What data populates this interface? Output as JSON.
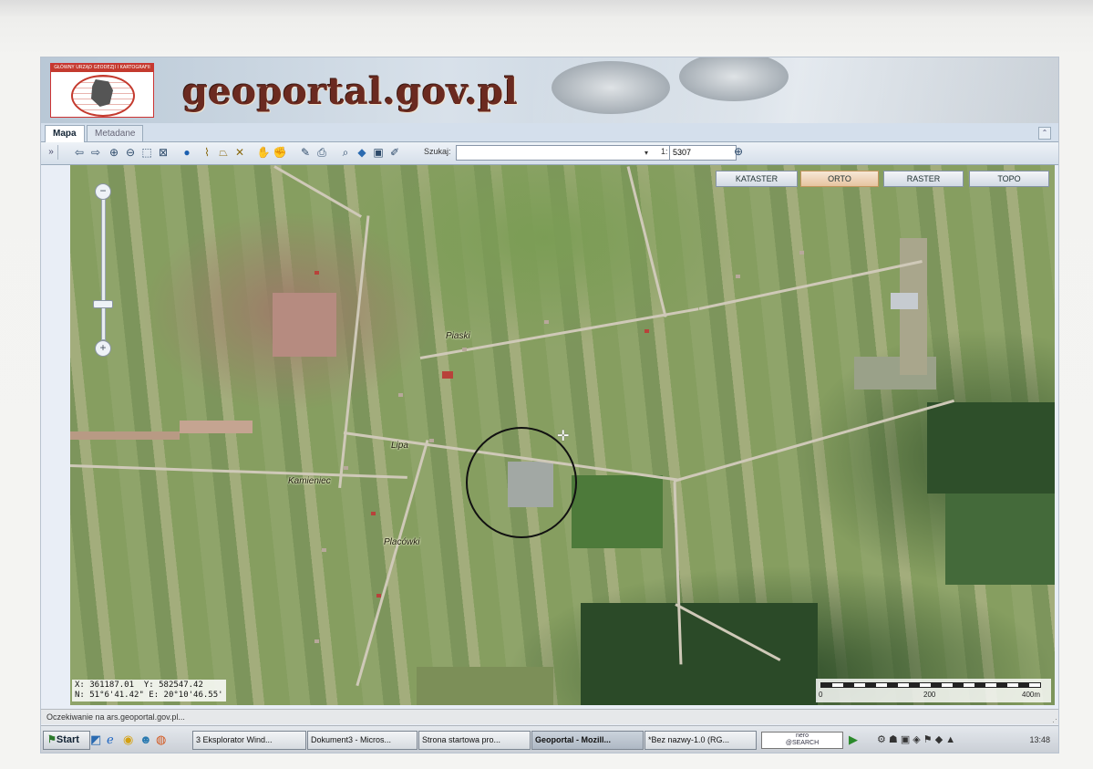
{
  "header": {
    "logo_text": "GŁÓWNY URZĄD GEODEZJI I KARTOGRAFII",
    "site_title": "geoportal.gov.pl"
  },
  "tabs": [
    {
      "label": "Mapa",
      "active": true
    },
    {
      "label": "Metadane",
      "active": false
    }
  ],
  "toolbar": {
    "expand_label": "»",
    "search_label": "Szukaj:",
    "search_value": "",
    "scale_prefix": "1:",
    "scale_value": "5307",
    "tools": [
      "arrow-left-icon",
      "arrow-right-icon",
      "zoom-in-icon",
      "zoom-out-icon",
      "zoom-box-icon",
      "full-extent-icon",
      "info-icon",
      "measure-line-icon",
      "measure-area-icon",
      "clear-measure-icon",
      "pan-icon",
      "grab-icon",
      "edit-icon",
      "print-icon",
      "find-icon",
      "layers-icon",
      "save-icon",
      "draw-icon"
    ]
  },
  "layer_buttons": [
    {
      "label": "KATASTER",
      "active": false
    },
    {
      "label": "ORTO",
      "active": true
    },
    {
      "label": "RASTER",
      "active": false
    },
    {
      "label": "TOPO",
      "active": false
    }
  ],
  "places": [
    "Piaski",
    "Lipa",
    "Kamieniec",
    "Placówki"
  ],
  "coords": {
    "x": "X: 361187.01",
    "y": "Y: 582547.42",
    "n": "N: 51°6'41.42\"",
    "e": "E: 20°10'46.55'"
  },
  "scalebar": {
    "labels": [
      "0",
      "200",
      "400m"
    ]
  },
  "status": {
    "text": "Oczekiwanie na ars.geoportal.gov.pl..."
  },
  "taskbar": {
    "start_label": "Start",
    "tasks": [
      {
        "label": "3 Eksplorator Wind...",
        "active": false
      },
      {
        "label": "Dokument3 - Micros...",
        "active": false
      },
      {
        "label": "Strona startowa pro...",
        "active": false
      },
      {
        "label": "Geoportal - Mozill...",
        "active": true
      },
      {
        "label": "*Bez nazwy-1.0 (RG...",
        "active": false
      }
    ],
    "nero_top": "nero",
    "nero_bottom": "@SEARCH",
    "clock": "13:48"
  },
  "colors": {
    "brand_red": "#c43a2e",
    "title_brown": "#6b2a20",
    "active_layer": "#e6c4a0"
  }
}
